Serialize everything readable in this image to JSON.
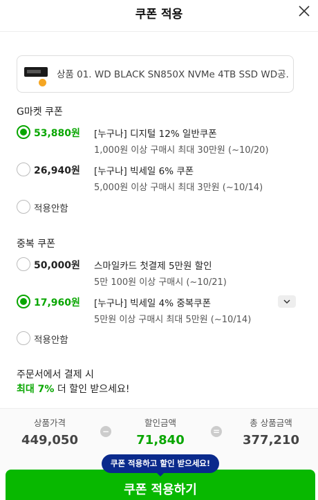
{
  "header": {
    "title": "쿠폰 적용"
  },
  "product": {
    "name": "상품 01. WD BLACK SN850X NVMe 4TB SSD WD공..."
  },
  "gmarket": {
    "title": "G마켓 쿠폰",
    "coupons": [
      {
        "amount": "53,880",
        "unit": "원",
        "name": "[누구나] 디지털 12% 일반쿠폰",
        "condition": "1,000원 이상 구매시 최대 30만원 (~10/20)",
        "selected": true
      },
      {
        "amount": "26,940",
        "unit": "원",
        "name": "[누구나] 빅세일 6% 쿠폰",
        "condition": "5,000원 이상 구매시 최대 3만원 (~10/14)",
        "selected": false
      }
    ],
    "none_label": "적용안함"
  },
  "duplicate": {
    "title": "중복 쿠폰",
    "coupons": [
      {
        "amount": "50,000",
        "unit": "원",
        "name": "스마일카드 첫결제 5만원 할인",
        "condition": "5만 100원 이상 구매시 (~10/21)",
        "selected": false
      },
      {
        "amount": "17,960",
        "unit": "원",
        "name": "[누구나] 빅세일 4% 중복쿠폰",
        "condition": "5만원 이상 구매시 최대 5만원 (~10/14)",
        "selected": true
      }
    ],
    "none_label": "적용안함"
  },
  "promo": {
    "line1": "주문서에서 결제 시",
    "highlight": "최대 7%",
    "line2_rest": " 더 할인 받으세요!"
  },
  "summary": {
    "price_label": "상품가격",
    "price_value": "449,050",
    "discount_label": "할인금액",
    "discount_value": "71,840",
    "total_label": "총 상품금액",
    "total_value": "377,210",
    "minus_symbol": "−",
    "equals_symbol": "="
  },
  "tooltip": {
    "text": "쿠폰 적용하고 할인 받으세요!"
  },
  "apply_button": {
    "label": "쿠폰 적용하기"
  },
  "colors": {
    "accent": "#08a600",
    "button": "#08b800",
    "tooltip": "#0a2a8c"
  },
  "icons": {
    "close": "close-icon",
    "expand": "chevron-down-icon"
  }
}
